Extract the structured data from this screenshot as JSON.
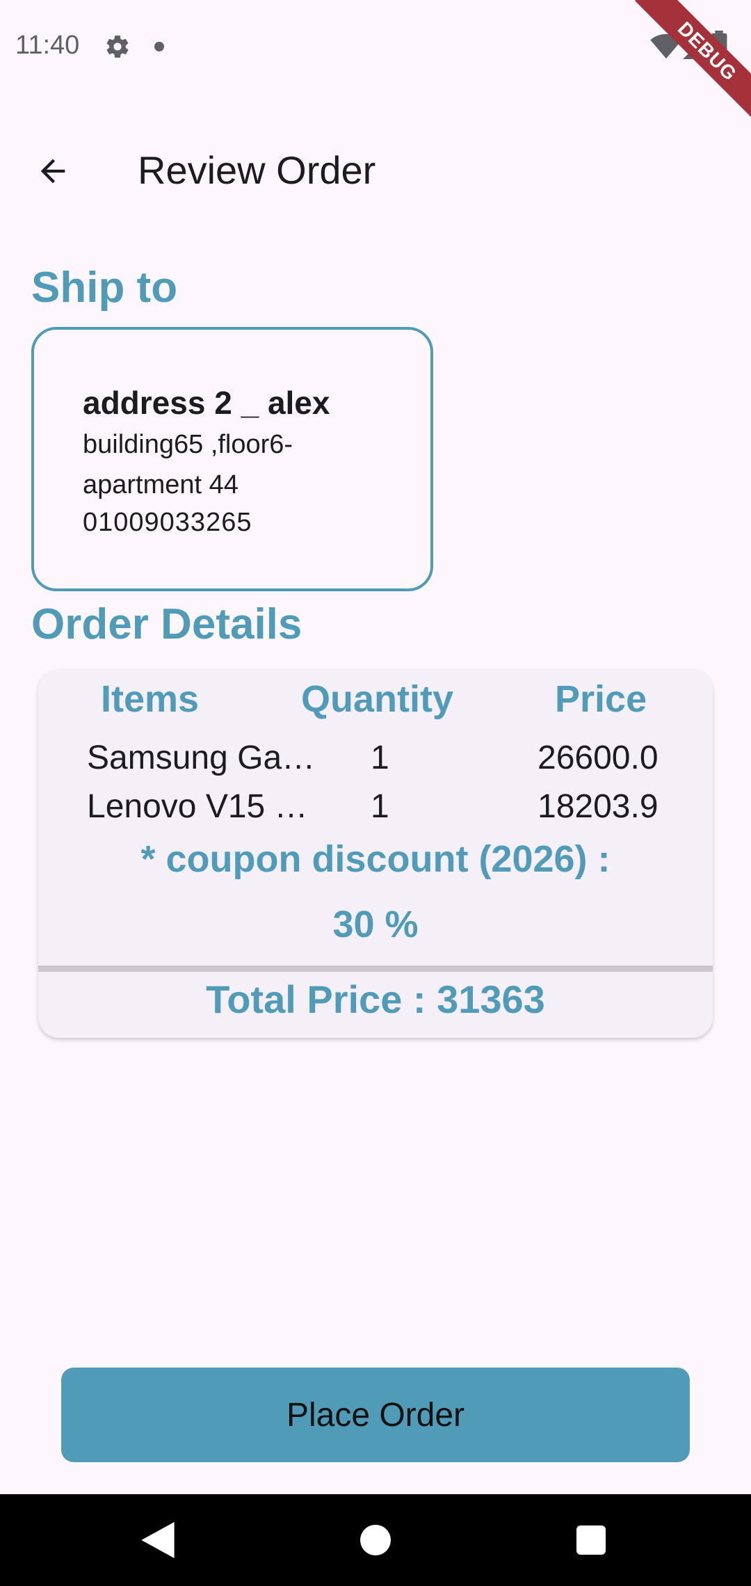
{
  "status_bar": {
    "time": "11:40",
    "debug_label": "DEBUG"
  },
  "app_bar": {
    "back_icon": "arrow-left-icon",
    "title": "Review Order"
  },
  "ship_to": {
    "title": "Ship to",
    "address": {
      "name": "address 2 _ alex",
      "line": "building65 ,floor6-apartment 44",
      "phone": "01009033265"
    }
  },
  "order_details": {
    "title": "Order Details",
    "columns": [
      "Items",
      "Quantity",
      "Price"
    ],
    "rows": [
      {
        "item": "Samsung Ga…",
        "quantity": "1",
        "price": "26600.0"
      },
      {
        "item": "Lenovo V15 …",
        "quantity": "1",
        "price": "18203.9"
      }
    ],
    "coupon_line1": "* coupon discount (2026)  :",
    "coupon_line2": "30 %",
    "total": "Total Price : 31363"
  },
  "actions": {
    "place_order_label": "Place Order"
  },
  "colors": {
    "accent": "#4f9bb8",
    "background": "#fdf7fd",
    "card": "#f5eff7"
  }
}
